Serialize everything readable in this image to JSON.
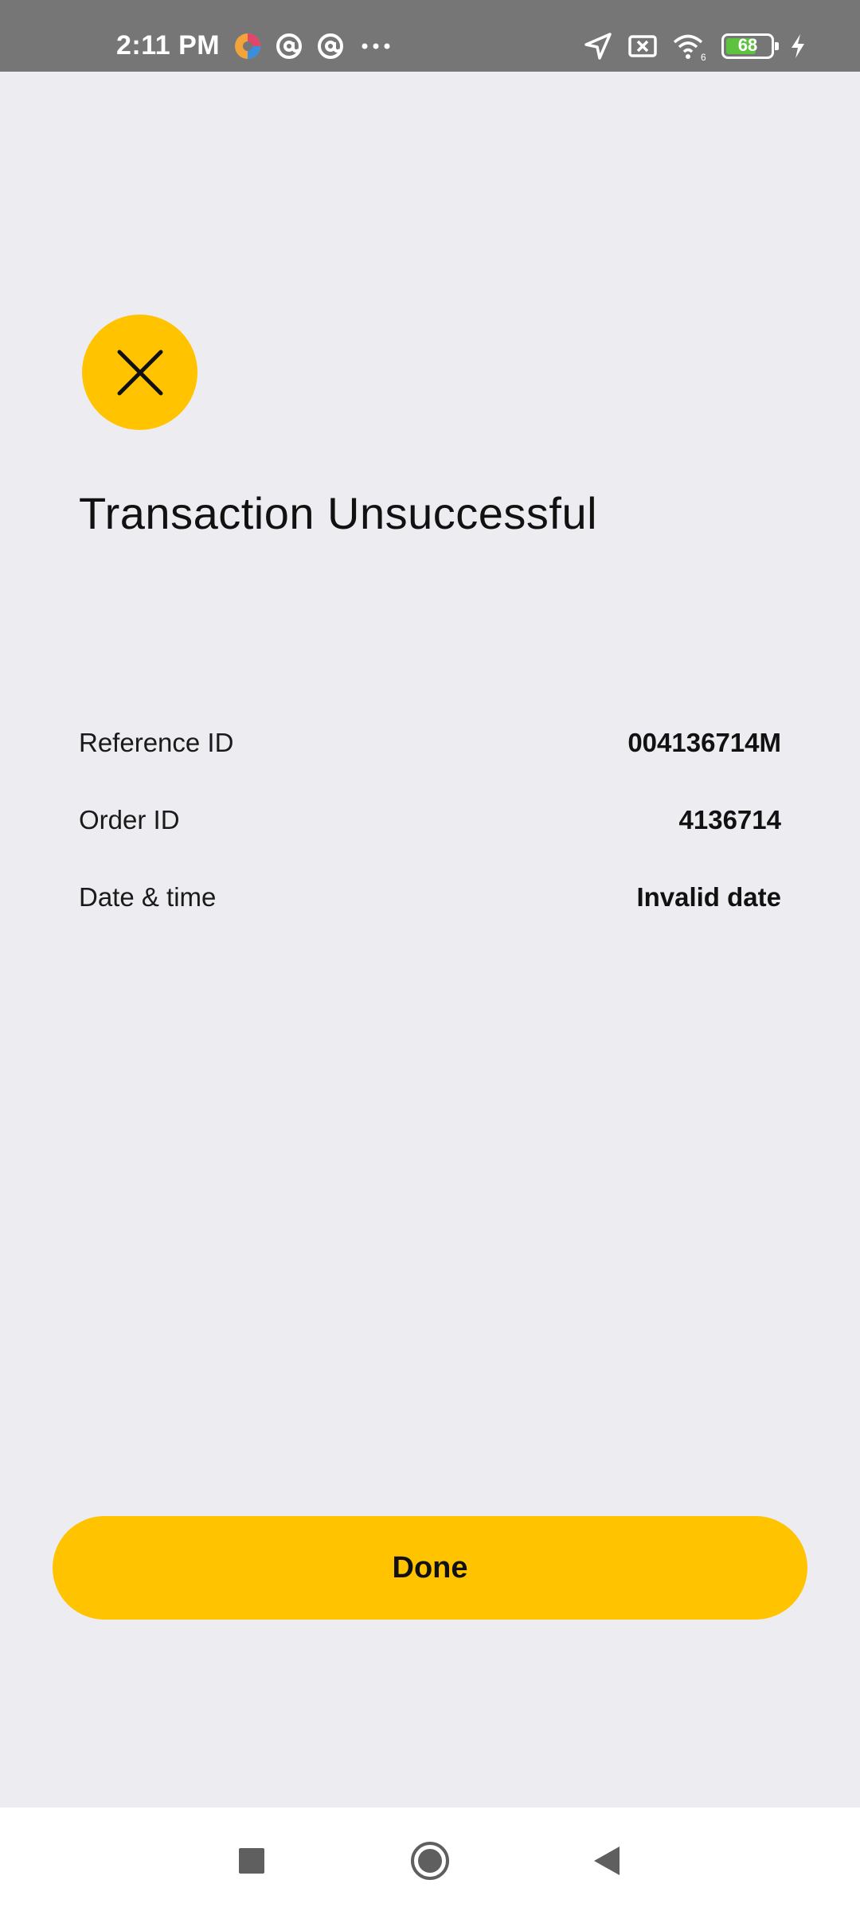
{
  "status_bar": {
    "time": "2:11 PM",
    "battery_level": "68",
    "battery_fraction": 0.68,
    "left_icons": [
      "app-notification-icon",
      "at-sign-icon",
      "at-sign-icon",
      "more-dots-icon"
    ],
    "right_icons": [
      "location-arrow-icon",
      "no-sim-icon",
      "wifi-icon",
      "battery-icon",
      "charging-bolt-icon"
    ]
  },
  "result": {
    "status_icon": "close-icon",
    "title": "Transaction Unsuccessful",
    "details": [
      {
        "label": "Reference ID",
        "value": "004136714M"
      },
      {
        "label": "Order ID",
        "value": "4136714"
      },
      {
        "label": "Date & time",
        "value": "Invalid date"
      }
    ]
  },
  "actions": {
    "done_label": "Done"
  },
  "navigation": {
    "buttons": [
      "recents-square-icon",
      "home-circle-icon",
      "back-triangle-icon"
    ]
  },
  "colors": {
    "accent": "#FFC300",
    "background": "#EDEDF1",
    "status_bar": "#767676",
    "battery": "#5DC23E"
  }
}
